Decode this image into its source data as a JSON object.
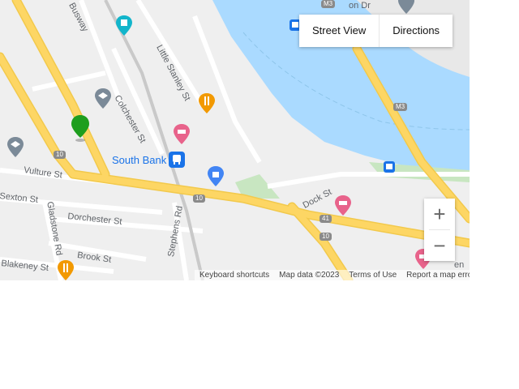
{
  "map": {
    "buttons": {
      "street_view": "Street View",
      "directions": "Directions"
    },
    "zoom": {
      "in": "+",
      "out": "−"
    },
    "attribution": {
      "keyboard": "Keyboard shortcuts",
      "data": "Map data ©2023",
      "terms": "Terms of Use",
      "report": "Report a map error"
    },
    "streets": {
      "busway": "Busway",
      "colchester": "Colchester St",
      "little_stanley": "Little Stanley St",
      "vulture": "Vulture St",
      "sexton": "Sexton St",
      "gladstone": "Gladstone Rd",
      "dorchester": "Dorchester St",
      "stephens": "Stephens Rd",
      "brook": "Brook St",
      "blakeney": "Blakeney St",
      "dock": "Dock St",
      "on_dr": "on Dr",
      "en": "en"
    },
    "places": {
      "south_bank": "South Bank"
    },
    "route_shields": {
      "m3_top": "M3",
      "m3": "M3",
      "r10a": "10",
      "r10b": "10",
      "r10c": "10",
      "r41": "41"
    },
    "colors": {
      "water": "#aadaff",
      "road": "#fdd664",
      "road_edge": "#f2c94c",
      "park": "#c8e6c1",
      "pin": "#1e9e1e"
    }
  }
}
